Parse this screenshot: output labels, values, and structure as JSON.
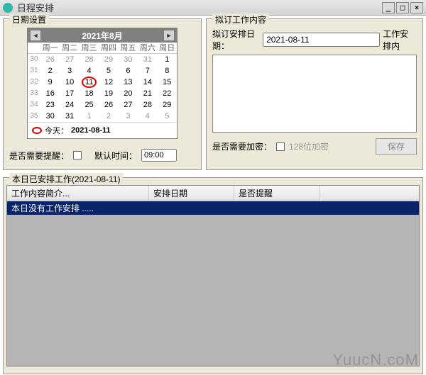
{
  "window": {
    "title": "日程安排",
    "min": "_",
    "max": "□",
    "close": "×"
  },
  "date_group": {
    "title": "日期设置",
    "cal_title": "2021年8月",
    "dow": [
      "周一",
      "周二",
      "周三",
      "周四",
      "周五",
      "周六",
      "周日"
    ],
    "weeks": [
      "30",
      "31",
      "32",
      "33",
      "34",
      "35"
    ],
    "grid": [
      [
        "26",
        "27",
        "28",
        "29",
        "30",
        "31",
        "1"
      ],
      [
        "2",
        "3",
        "4",
        "5",
        "6",
        "7",
        "8"
      ],
      [
        "9",
        "10",
        "11",
        "12",
        "13",
        "14",
        "15"
      ],
      [
        "16",
        "17",
        "18",
        "19",
        "20",
        "21",
        "22"
      ],
      [
        "23",
        "24",
        "25",
        "26",
        "27",
        "28",
        "29"
      ],
      [
        "30",
        "31",
        "1",
        "2",
        "3",
        "4",
        "5"
      ]
    ],
    "today_label": "今天：",
    "today_value": "2021-08-11",
    "remind_label": "是否需要提醒：",
    "default_time_label": "默认时间：",
    "default_time_value": "09:00"
  },
  "work_group": {
    "title": "拟订工作内容",
    "date_label": "拟订安排日期：",
    "date_value": "2021-08-11",
    "right_label": "工作安排内",
    "enc_label": "是否需要加密：",
    "enc_option": "128位加密",
    "save_label": "保存"
  },
  "list_group": {
    "title": "本日已安排工作(2021-08-11)",
    "cols": {
      "a": "工作内容简介...",
      "b": "安排日期",
      "c": "是否提醒"
    },
    "empty_row": "本日没有工作安排 ....."
  },
  "watermark": "YuucN.coM"
}
